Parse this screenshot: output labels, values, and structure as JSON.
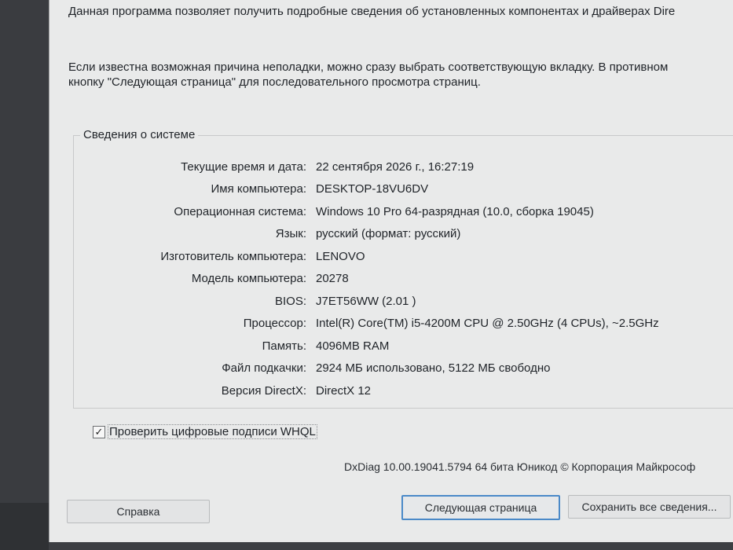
{
  "intro": {
    "line1": "Данная программа позволяет получить подробные сведения об установленных компонентах и драйверах Dire",
    "line2": "Если известна возможная причина неполадки, можно сразу выбрать соответствующую вкладку. В противном",
    "line3": "кнопку \"Следующая страница\" для последовательного просмотра страниц."
  },
  "system_info": {
    "title": "Сведения о системе",
    "rows": [
      {
        "label": "Текущие время и дата:",
        "value": "22 сентября 2026 г., 16:27:19"
      },
      {
        "label": "Имя компьютера:",
        "value": "DESKTOP-18VU6DV"
      },
      {
        "label": "Операционная система:",
        "value": "Windows 10 Pro 64-разрядная (10.0, сборка 19045)"
      },
      {
        "label": "Язык:",
        "value": "русский (формат: русский)"
      },
      {
        "label": "Изготовитель компьютера:",
        "value": "LENOVO"
      },
      {
        "label": "Модель компьютера:",
        "value": "20278"
      },
      {
        "label": "BIOS:",
        "value": "J7ET56WW (2.01 )"
      },
      {
        "label": "Процессор:",
        "value": "Intel(R) Core(TM) i5-4200M CPU @ 2.50GHz (4 CPUs), ~2.5GHz"
      },
      {
        "label": "Память:",
        "value": "4096MB RAM"
      },
      {
        "label": "Файл подкачки:",
        "value": "2924 МБ использовано, 5122 МБ свободно"
      },
      {
        "label": "Версия DirectX:",
        "value": "DirectX 12"
      }
    ]
  },
  "whql_checkbox": {
    "label": "Проверить цифровые подписи WHQL",
    "checked": true,
    "mark": "✓"
  },
  "version_text": "DxDiag 10.00.19041.5794 64 бита Юникод © Корпорация Майкрософ",
  "buttons": {
    "help": "Справка",
    "next_page": "Следующая страница",
    "save_all": "Сохранить все сведения..."
  }
}
